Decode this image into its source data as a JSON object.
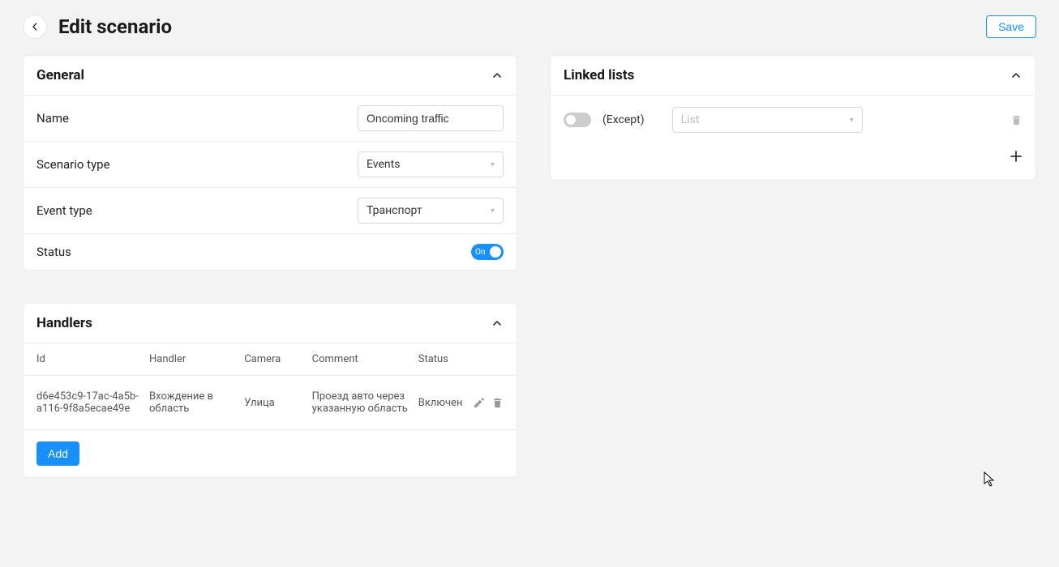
{
  "header": {
    "title": "Edit scenario",
    "save_label": "Save"
  },
  "general": {
    "title": "General",
    "name_label": "Name",
    "name_value": "Oncoming traffic",
    "scenario_type_label": "Scenario type",
    "scenario_type_value": "Events",
    "event_type_label": "Event type",
    "event_type_value": "Транспорт",
    "status_label": "Status",
    "status_toggle_text": "On"
  },
  "handlers": {
    "title": "Handlers",
    "columns": {
      "id": "Id",
      "handler": "Handler",
      "camera": "Camera",
      "comment": "Comment",
      "status": "Status"
    },
    "rows": [
      {
        "id": "d6e453c9-17ac-4a5b-a116-9f8a5ecae49e",
        "handler": "Вхождение в область",
        "camera": "Улица",
        "comment": "Проезд авто через указанную область",
        "status": "Включен"
      }
    ],
    "add_label": "Add"
  },
  "linked": {
    "title": "Linked lists",
    "except_label": "(Except)",
    "list_placeholder": "List"
  }
}
